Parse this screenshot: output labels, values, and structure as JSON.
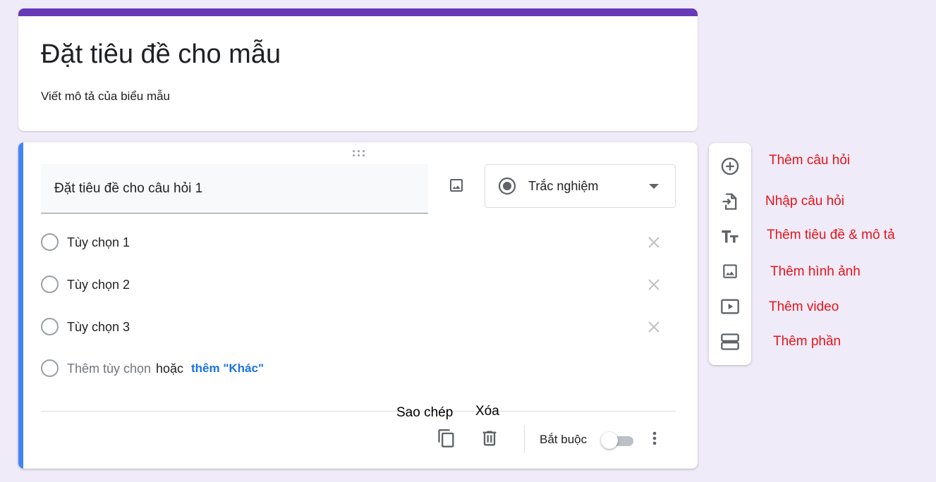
{
  "form": {
    "title": "Đặt tiêu đề cho mẫu",
    "description": "Viết mô tả của biểu mẫu"
  },
  "question": {
    "title": "Đặt tiêu đề cho câu hỏi 1",
    "type": "Trắc nghiệm",
    "options": [
      "Tùy chọn 1",
      "Tùy chọn 2",
      "Tùy chọn 3"
    ],
    "add_option": "Thêm tùy chọn",
    "or": "hoặc",
    "add_other": "thêm \"Khác\"",
    "required_label": "Bắt buộc",
    "required": false
  },
  "annotations": {
    "copy": "Sao chép",
    "delete": "Xóa"
  },
  "sidebar": {
    "items": [
      {
        "label": "Thêm câu hỏi",
        "icon": "add-circle-icon"
      },
      {
        "label": "Nhập câu hỏi",
        "icon": "import-icon"
      },
      {
        "label": "Thêm tiêu đề & mô tả",
        "icon": "title-text-icon"
      },
      {
        "label": "Thêm hình ảnh",
        "icon": "image-icon"
      },
      {
        "label": "Thêm video",
        "icon": "video-icon"
      },
      {
        "label": "Thêm phần",
        "icon": "section-icon"
      }
    ]
  },
  "colors": {
    "theme": "#673ab7",
    "active_bar": "#4285f4",
    "background": "#f0ebf8",
    "label_red": "#e8131a",
    "link": "#1a73e8"
  }
}
